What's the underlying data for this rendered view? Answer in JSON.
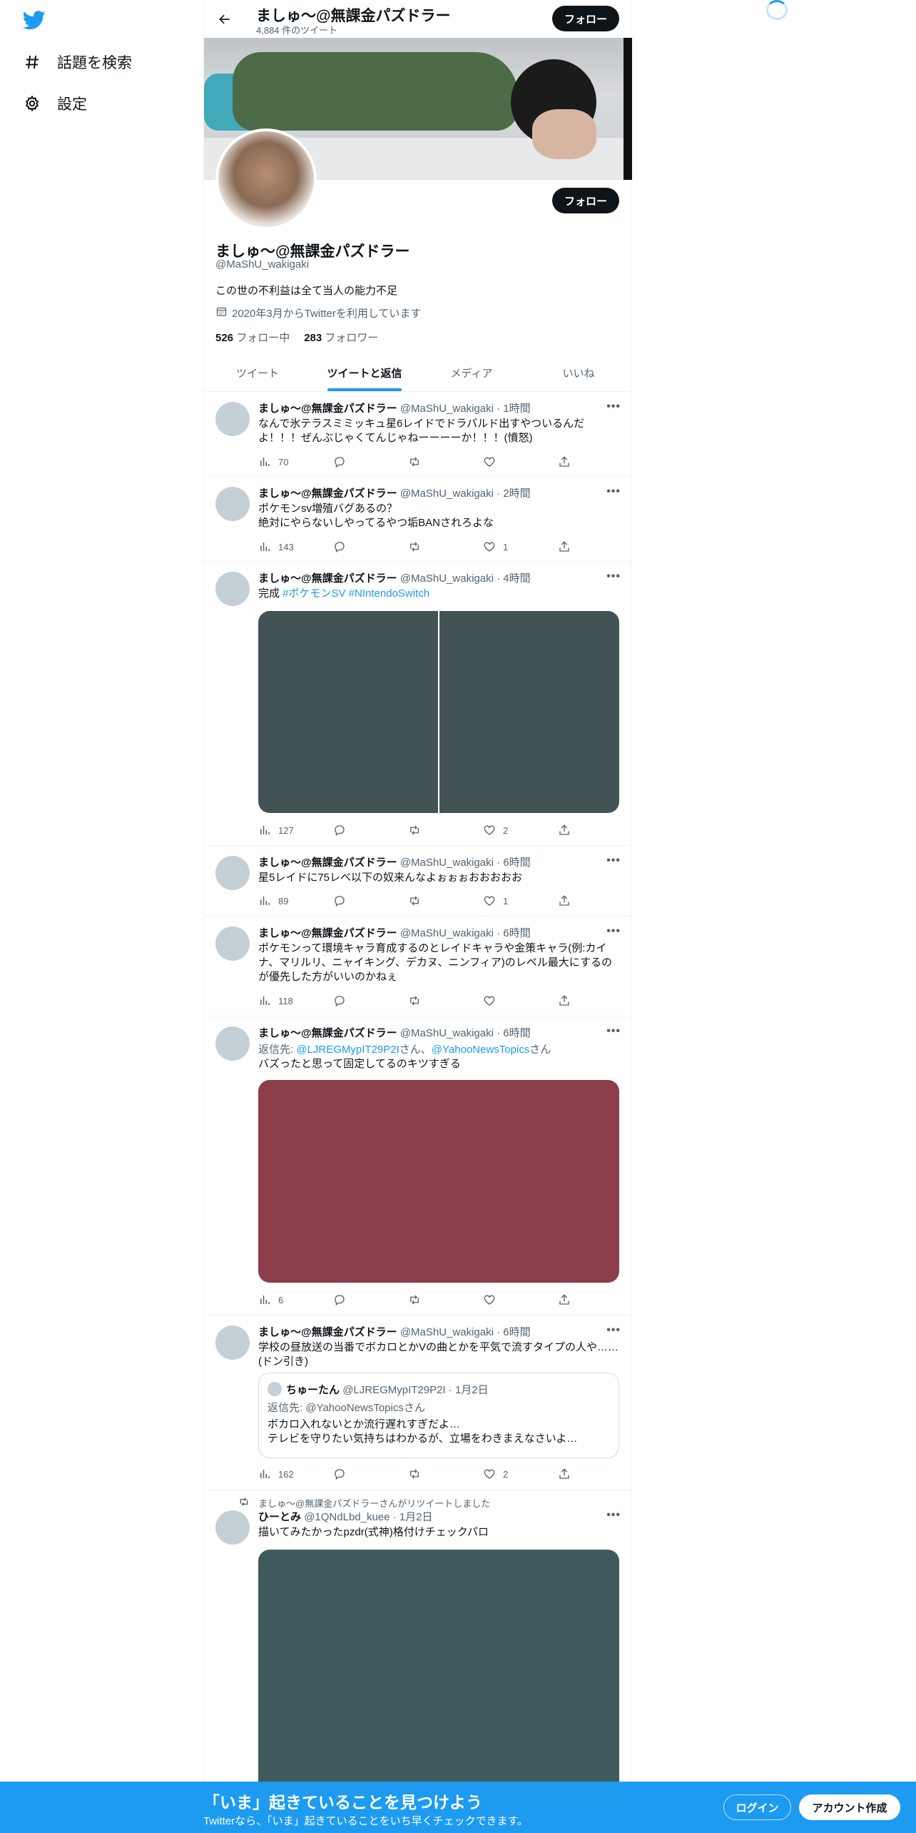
{
  "nav": {
    "explore_label": "話題を検索",
    "settings_label": "設定"
  },
  "header": {
    "title": "ましゅ〜@無課金パズドラー",
    "subtitle": "4,884 件のツイート",
    "follow_label": "フォロー"
  },
  "profile": {
    "name": "ましゅ〜@無課金パズドラー",
    "handle": "@MaShU_wakigaki",
    "bio": "この世の不利益は全て当人の能力不足",
    "joined": "2020年3月からTwitterを利用しています",
    "following_count": "526",
    "following_label": "フォロー中",
    "followers_count": "283",
    "followers_label": "フォロワー",
    "follow_label": "フォロー"
  },
  "tabs": [
    "ツイート",
    "ツイートと返信",
    "メディア",
    "いいね"
  ],
  "tweets": [
    {
      "name": "ましゅ〜@無課金パズドラー",
      "meta": "@MaShU_wakigaki · 1時間",
      "text1": "なんで氷テラスミミッキュ星6レイドでドラパルド出すやついるんだよ！！！ぜんぶじゃくてんじゃねーーーーか！！！(憤怒)",
      "views": "70",
      "likes": ""
    },
    {
      "name": "ましゅ〜@無課金パズドラー",
      "meta": "@MaShU_wakigaki · 2時間",
      "text1": "ポケモンsv増殖バグあるの？",
      "text2": "絶対にやらないしやってるやつ垢BANされろよな",
      "views": "143",
      "likes": "1"
    },
    {
      "name": "ましゅ〜@無課金パズドラー",
      "meta": "@MaShU_wakigaki · 4時間",
      "text_prefix": "完成 ",
      "tag1": "#ポケモンSV",
      "tag2": "#NIntendoSwitch",
      "views": "127",
      "likes": "2"
    },
    {
      "name": "ましゅ〜@無課金パズドラー",
      "meta": "@MaShU_wakigaki · 6時間",
      "text1": "星5レイドに75レベ以下の奴来んなよぉぉぉおおおおお",
      "views": "89",
      "likes": "1"
    },
    {
      "name": "ましゅ〜@無課金パズドラー",
      "meta": "@MaShU_wakigaki · 6時間",
      "text1": "ポケモンって環境キャラ育成するのとレイドキャラや金策キャラ(例:カイナ、マリルリ、ニャイキング、デカヌ、ニンフィア)のレベル最大にするのが優先した方がいいのかねぇ",
      "views": "118",
      "likes": ""
    },
    {
      "name": "ましゅ〜@無課金パズドラー",
      "meta": "@MaShU_wakigaki · 6時間",
      "reply_prefix": "返信先: ",
      "reply_user1": "@LJREGMypIT29P2I",
      "reply_mid": "さん、",
      "reply_user2": "@YahooNewsTopics",
      "reply_suffix": "さん",
      "text1": "バズったと思って固定してるのキツすぎる",
      "views": "6",
      "likes": ""
    },
    {
      "name": "ましゅ〜@無課金パズドラー",
      "meta": "@MaShU_wakigaki · 6時間",
      "text1": "学校の昼放送の当番でボカロとかVの曲とかを平気で流すタイプの人や……(ドン引き)",
      "views": "162",
      "likes": "2",
      "quote": {
        "name": "ちゅーたん",
        "meta": "@LJREGMypIT29P2I · 1月2日",
        "reply": "返信先: @YahooNewsTopicsさん",
        "text1": "ボカロ入れないとか流行遅れすぎだよ…",
        "text2": "テレビを守りたい気持ちはわかるが、立場をわきまえなさいよ…"
      }
    },
    {
      "retweet_note": "ましゅ〜@無課金パズドラーさんがリツイートしました",
      "name": "ひーとみ",
      "meta": "@1QNdLbd_kuee · 1月2日",
      "text1": "描いてみたかったpzdr(式神)格付けチェックパロ"
    }
  ],
  "bottom": {
    "title": "「いま」起きていることを見つけよう",
    "subtitle": "Twitterなら、「いま」起きていることをいち早くチェックできます。",
    "login_label": "ログイン",
    "signup_label": "アカウント作成"
  },
  "colors": {
    "accent": "#1d9bf0",
    "media_dark": "#435255",
    "media_red": "#8c3e4b",
    "media_teal": "#3f5a5c"
  }
}
